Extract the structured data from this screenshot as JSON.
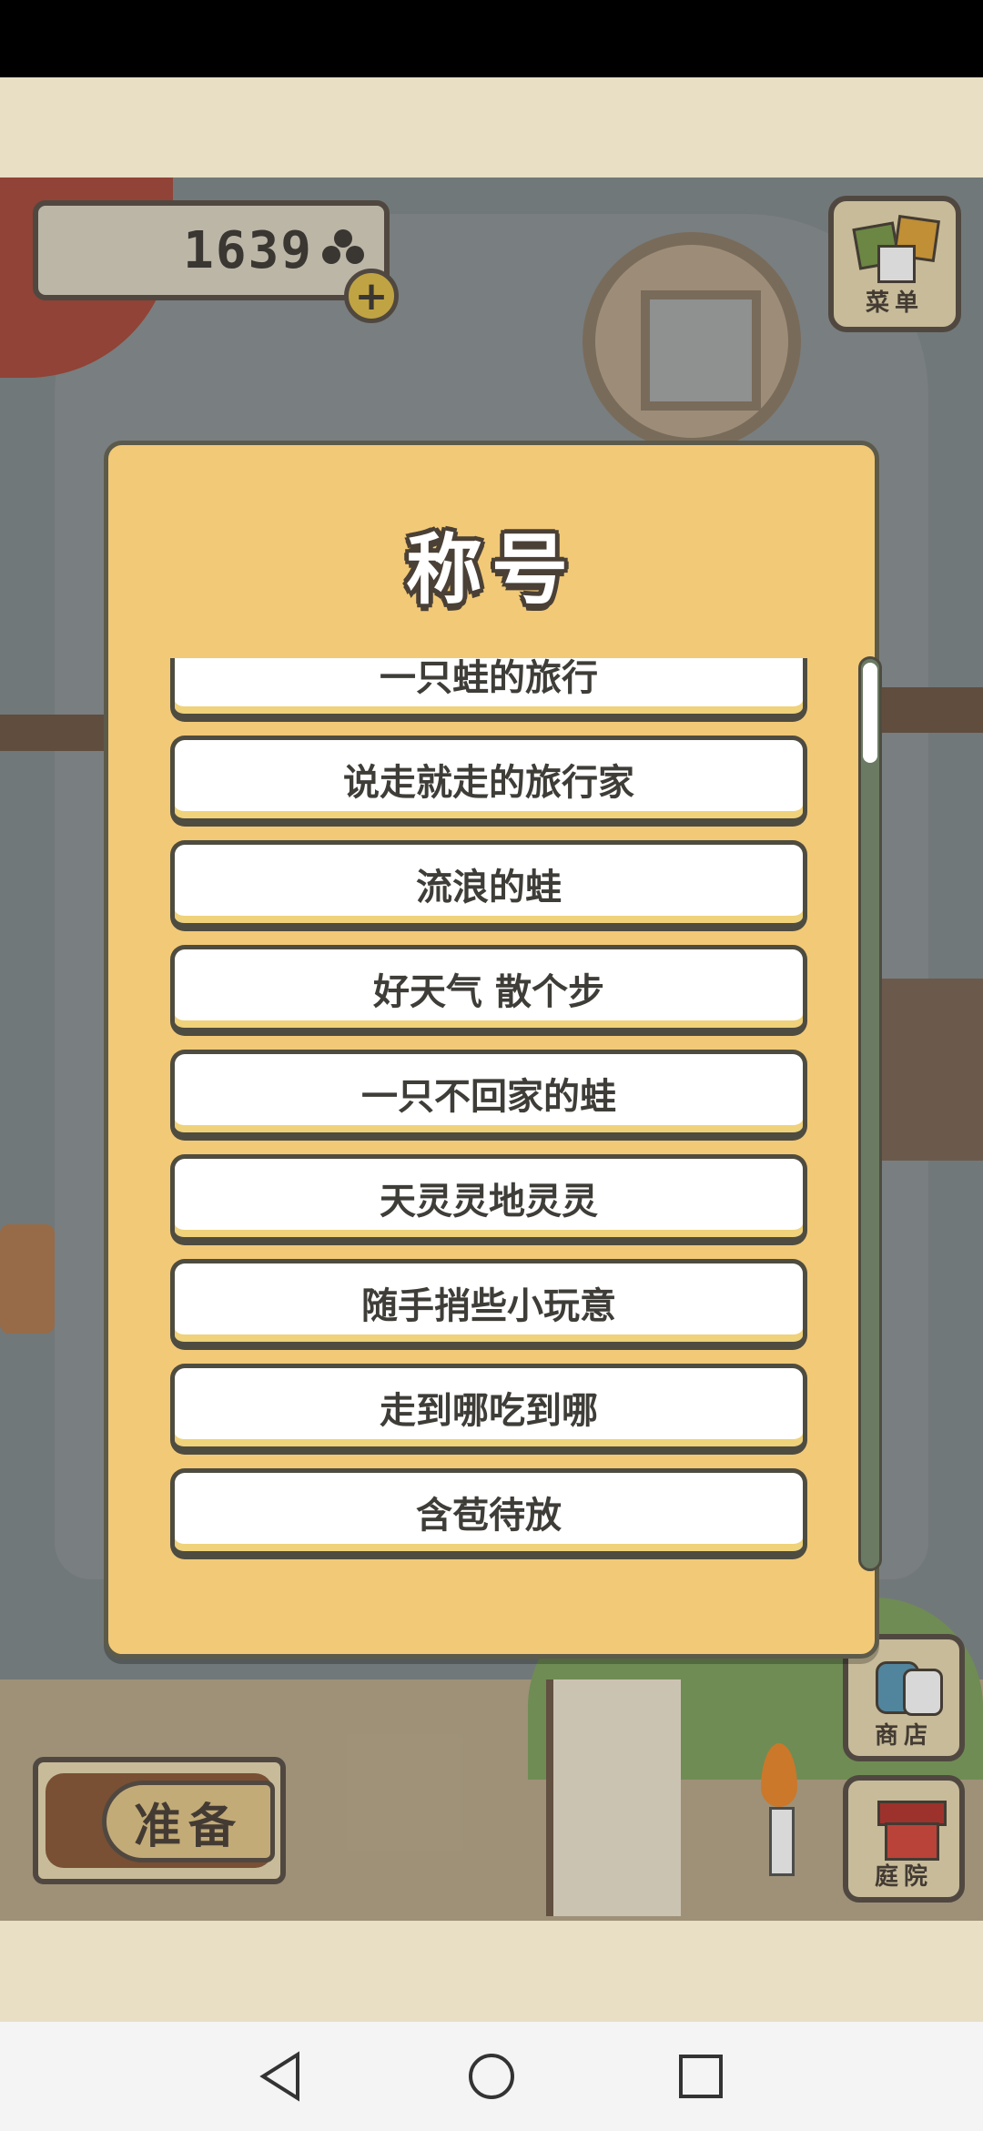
{
  "hud": {
    "currency_value": "1639",
    "currency_icon": "clover-icon",
    "add_currency_icon": "plus-icon",
    "menu_label": "菜单",
    "ready_label": "准备",
    "shop_label": "商店",
    "yard_label": "庭院"
  },
  "dialog": {
    "title": "称号",
    "items": [
      "一只蛙的旅行",
      "说走就走的旅行家",
      "流浪的蛙",
      "好天气 散个步",
      "一只不回家的蛙",
      "天灵灵地灵灵",
      "随手捎些小玩意",
      "走到哪吃到哪",
      "含苞待放"
    ]
  },
  "navbar": {
    "back_icon": "back-triangle-icon",
    "home_icon": "home-circle-icon",
    "recents_icon": "recents-square-icon"
  }
}
